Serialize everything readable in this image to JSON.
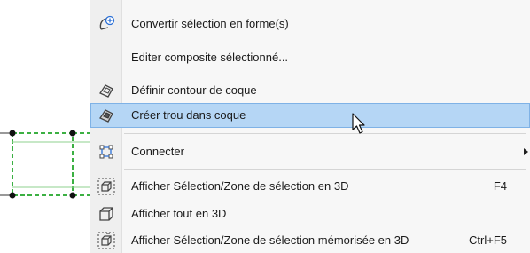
{
  "menu": {
    "items": [
      {
        "label": "Convertir sélection en forme(s)",
        "icon": "convert-shape-icon"
      },
      {
        "label": "Editer composite sélectionné...",
        "icon": ""
      },
      {
        "label": "Définir contour de coque",
        "icon": "shell-contour-icon"
      },
      {
        "label": "Créer trou dans coque",
        "icon": "shell-hole-icon",
        "highlighted": true
      },
      {
        "label": "Connecter",
        "icon": "connect-icon",
        "submenu": true
      },
      {
        "label": "Afficher Sélection/Zone de sélection en 3D",
        "icon": "3d-selection-icon",
        "shortcut": "F4"
      },
      {
        "label": "Afficher tout en 3D",
        "icon": "3d-all-icon"
      },
      {
        "label": "Afficher Sélection/Zone de sélection mémorisée en 3D",
        "icon": "3d-saved-selection-icon",
        "shortcut": "Ctrl+F5"
      }
    ]
  },
  "colors": {
    "highlight": "#b5d6f5",
    "highlight_border": "#7fb2e6",
    "selection_green": "#3cb043"
  }
}
